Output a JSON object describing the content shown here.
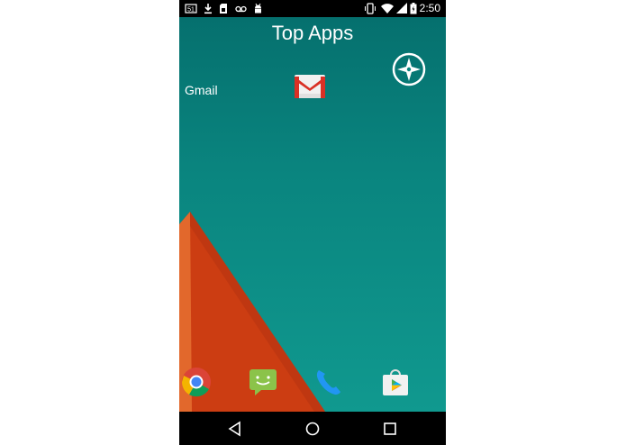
{
  "status_bar": {
    "time": "2:50",
    "left_icons": [
      "notification-badge-icon",
      "download-icon",
      "sim-icon",
      "voicemail-icon",
      "android-icon"
    ],
    "right_icons": [
      "vibrate-icon",
      "wifi-icon",
      "signal-icon",
      "battery-icon"
    ]
  },
  "home": {
    "title": "Top Apps",
    "top_right_icon": "compass-icon",
    "app": {
      "label": "Gmail",
      "icon": "gmail-icon"
    },
    "dock": [
      "chrome-icon",
      "messaging-icon",
      "phone-icon",
      "play-store-icon"
    ]
  },
  "nav_bar": [
    "back-icon",
    "home-icon",
    "recents-icon"
  ],
  "colors": {
    "wallpaper_top": "#05706e",
    "wallpaper_bottom": "#10998f",
    "triangle": "#cc3d12",
    "triangle_edge": "#e2682c",
    "status_bar_bg": "#000000"
  }
}
